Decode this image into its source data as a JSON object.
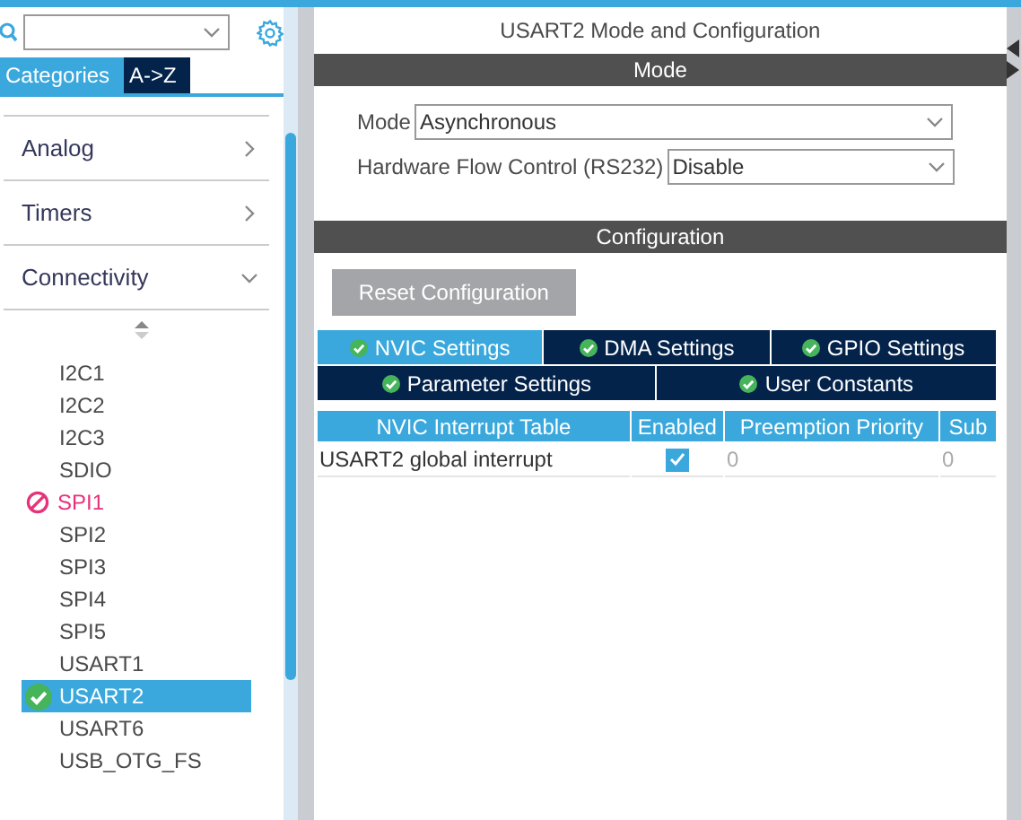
{
  "sidebar": {
    "tabs": [
      {
        "label": "Categories",
        "selected": true
      },
      {
        "label": "A->Z",
        "selected": false
      }
    ],
    "categories": [
      {
        "label": "Analog",
        "expanded": false
      },
      {
        "label": "Timers",
        "expanded": false
      },
      {
        "label": "Connectivity",
        "expanded": true
      }
    ],
    "peripherals": [
      {
        "label": "I2C1",
        "kind": "plain",
        "selected": false
      },
      {
        "label": "I2C2",
        "kind": "plain",
        "selected": false
      },
      {
        "label": "I2C3",
        "kind": "plain",
        "selected": false
      },
      {
        "label": "SDIO",
        "kind": "plain",
        "selected": false
      },
      {
        "label": "SPI1",
        "kind": "conflict",
        "selected": false
      },
      {
        "label": "SPI2",
        "kind": "plain",
        "selected": false
      },
      {
        "label": "SPI3",
        "kind": "plain",
        "selected": false
      },
      {
        "label": "SPI4",
        "kind": "plain",
        "selected": false
      },
      {
        "label": "SPI5",
        "kind": "plain",
        "selected": false
      },
      {
        "label": "USART1",
        "kind": "plain",
        "selected": false
      },
      {
        "label": "USART2",
        "kind": "configured",
        "selected": true
      },
      {
        "label": "USART6",
        "kind": "plain",
        "selected": false
      },
      {
        "label": "USB_OTG_FS",
        "kind": "plain",
        "selected": false
      }
    ]
  },
  "panel": {
    "title": "USART2 Mode and Configuration",
    "mode_header": "Mode",
    "mode_fields": [
      {
        "label": "Mode",
        "value": "Asynchronous"
      },
      {
        "label": "Hardware Flow Control (RS232)",
        "value": "Disable"
      }
    ],
    "config_header": "Configuration",
    "reset_button": "Reset Configuration",
    "tab_rows": [
      [
        {
          "label": "NVIC Settings",
          "selected": true
        },
        {
          "label": "DMA Settings",
          "selected": false
        },
        {
          "label": "GPIO Settings",
          "selected": false
        }
      ],
      [
        {
          "label": "Parameter Settings",
          "selected": false
        },
        {
          "label": "User Constants",
          "selected": false
        }
      ]
    ],
    "table": {
      "columns": [
        "NVIC Interrupt Table",
        "Enabled",
        "Preemption Priority",
        "Sub"
      ],
      "rows": [
        {
          "name": "USART2 global interrupt",
          "enabled": true,
          "preemption": "0",
          "sub": "0"
        }
      ]
    }
  }
}
